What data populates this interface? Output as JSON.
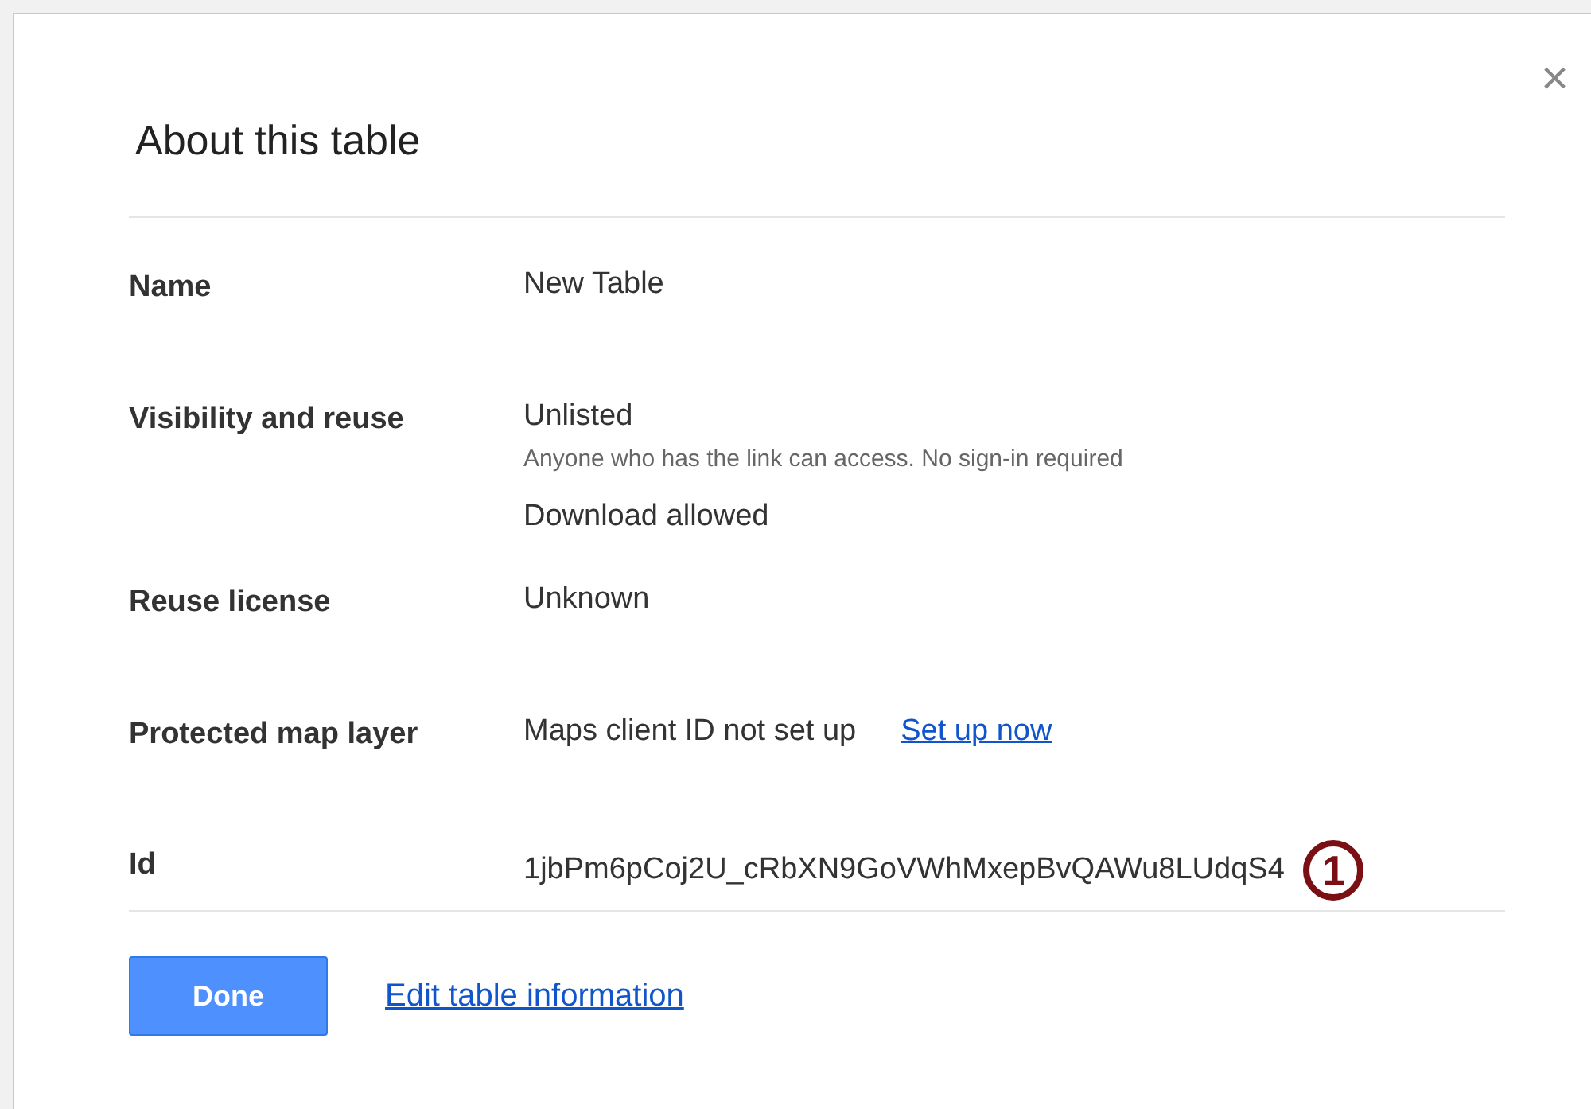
{
  "dialog": {
    "title": "About this table",
    "close": "×"
  },
  "rows": [
    {
      "label": "Name",
      "lines": [
        [
          {
            "kind": "text",
            "text": "New Table"
          }
        ]
      ]
    },
    {
      "label": "Visibility and reuse",
      "lines": [
        [
          {
            "kind": "text",
            "text": "Unlisted"
          }
        ],
        [
          {
            "kind": "note",
            "text": "Anyone who has the link can access. No sign-in required"
          }
        ],
        [
          {
            "kind": "text",
            "text": "Download allowed"
          }
        ]
      ]
    },
    {
      "label": "Reuse license",
      "lines": [
        [
          {
            "kind": "text",
            "text": "Unknown"
          }
        ]
      ]
    },
    {
      "label": "Protected map layer",
      "lines": [
        [
          {
            "kind": "text",
            "text": "Maps client ID not set up"
          },
          {
            "kind": "link",
            "text": "Set up now"
          }
        ]
      ]
    },
    {
      "label": "Id",
      "lines": [
        [
          {
            "kind": "text",
            "text": "1jbPm6pCoj2U_cRbXN9GoVWhMxepBvQAWu8LUdqS4"
          },
          {
            "kind": "callout",
            "text": "1"
          }
        ]
      ]
    }
  ],
  "buttons": {
    "primary": "Done",
    "link": "Edit table information"
  }
}
